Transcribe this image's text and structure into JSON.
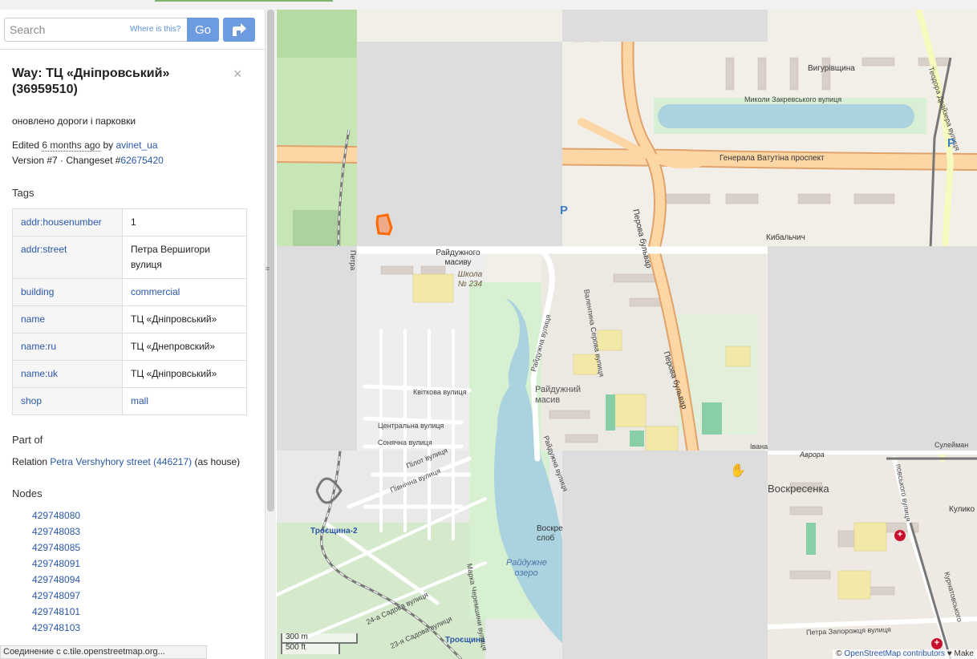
{
  "search": {
    "placeholder": "Search",
    "where_label": "Where is this?",
    "go_label": "Go"
  },
  "feature": {
    "title": "Way: ТЦ «Дніпровський» (36959510)",
    "comment": "оновлено дороги і парковки",
    "edited_prefix": "Edited",
    "edited_time": "6 months ago",
    "edited_by": "by",
    "user": "avinet_ua",
    "version_prefix": "Version #7 · Changeset #",
    "changeset": "62675420"
  },
  "tags": {
    "heading": "Tags",
    "rows": [
      {
        "key": "addr:housenumber",
        "value": "1"
      },
      {
        "key": "addr:street",
        "value": "Петра Вершигори вулиця"
      },
      {
        "key": "building",
        "value": "commercial"
      },
      {
        "key": "name",
        "value": "ТЦ «Дніпровський»"
      },
      {
        "key": "name:ru",
        "value": "ТЦ «Днепровский»"
      },
      {
        "key": "name:uk",
        "value": "ТЦ «Дніпровський»"
      },
      {
        "key": "shop",
        "value": "mall"
      }
    ]
  },
  "part_of": {
    "heading": "Part of",
    "prefix": "Relation",
    "relation": "Petra Vershyhory street (446217)",
    "suffix": "(as house)"
  },
  "nodes": {
    "heading": "Nodes",
    "items": [
      "429748080",
      "429748083",
      "429748085",
      "429748091",
      "429748094",
      "429748097",
      "429748101",
      "429748103"
    ]
  },
  "status_text": "Соединение с c.tile.openstreetmap.org...",
  "map": {
    "labels": {
      "vyhurivshchyna": "Вигурівщина",
      "zakrevskoho": "Миколи Закревського вулиця",
      "vatutina": "Генерала Ватутіна проспект",
      "teodora": "Теодора Драйзера вулиця",
      "kybalchych": "Кибальчич",
      "raiduzhnoho": "Райдужного масиву",
      "shkola": "Школа № 234",
      "perova1": "Перова бульвар",
      "perova2": "Перова бульвар",
      "serova": "Валентина Серова вулиця",
      "raiduzhna1": "Райдужна вулиця",
      "raiduzhna2": "Райдужна вулиця",
      "raiduzhnyi_masyv": "Райдужний масив",
      "kvitkova": "Квіткова вулиця",
      "tsentralna": "Центральна вулиця",
      "soniachna": "Сонячна вулиця",
      "pilot": "Пілот вулиця",
      "pivnichna": "Північна вулиця",
      "troieshchyna2": "Троєщина-2",
      "troieshchyna": "Троєщина",
      "voskresenka": "Воскресенка",
      "voskr": "Воскре слоб",
      "raiduzhne_ozero": "Райдужне озеро",
      "avrora": "Аврора",
      "suleiman": "Сулейман",
      "povskoho": "повського вулиця",
      "kuliko": "Кулико",
      "kurnatovskoho": "Курнатовського",
      "zaporozhtsia": "Петра Запорожця вулиця",
      "sadova24": "24-а Садова вулиця",
      "sadova23": "23-я Садова вулиця",
      "marka": "Марка Черемшини вулиця",
      "ivana": "Івана",
      "petra": "Петра"
    },
    "scale_m": "300 m",
    "scale_ft": "500 ft",
    "attribution_prefix": "©",
    "attribution_link": "OpenStreetMap contributors",
    "attribution_suffix": "♥ Make",
    "parking": "P"
  }
}
